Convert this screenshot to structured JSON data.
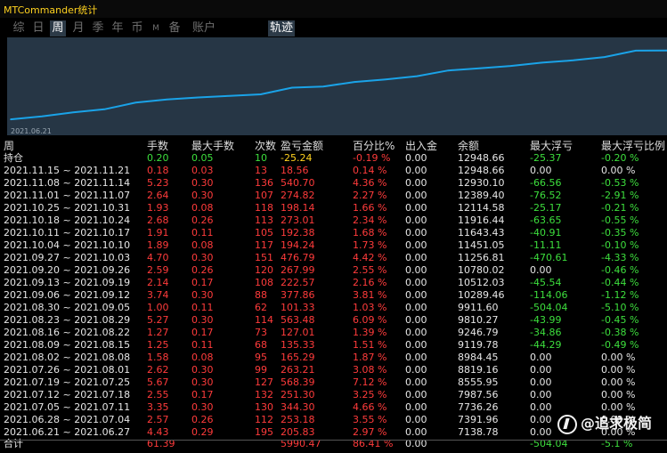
{
  "window": {
    "title": "MTCommander统计"
  },
  "tabs": [
    {
      "label": "综",
      "active": false
    },
    {
      "label": "日",
      "active": false
    },
    {
      "label": "周",
      "active": true
    },
    {
      "label": "月",
      "active": false
    },
    {
      "label": "季",
      "active": false
    },
    {
      "label": "年",
      "active": false
    },
    {
      "label": "币",
      "active": false
    },
    {
      "label": "M",
      "active": false
    },
    {
      "label": "备",
      "active": false
    },
    {
      "label": "账户",
      "active": false
    },
    {
      "label": "轨迹",
      "active": true
    }
  ],
  "chart_data": {
    "type": "line",
    "start_label": "2021.06.21",
    "x": [
      "2021.06.21",
      "2021.06.28",
      "2021.07.05",
      "2021.07.12",
      "2021.07.19",
      "2021.07.26",
      "2021.08.02",
      "2021.08.09",
      "2021.08.16",
      "2021.08.23",
      "2021.08.30",
      "2021.09.06",
      "2021.09.13",
      "2021.09.20",
      "2021.09.27",
      "2021.10.04",
      "2021.10.11",
      "2021.10.18",
      "2021.10.25",
      "2021.11.01",
      "2021.11.08",
      "2021.11.15"
    ],
    "values": [
      7138.78,
      7391.96,
      7736.26,
      7987.56,
      8555.95,
      8819.16,
      8984.45,
      9119.78,
      9246.79,
      9810.27,
      9911.6,
      10289.46,
      10512.03,
      10780.02,
      11256.81,
      11451.05,
      11643.43,
      11916.44,
      12114.58,
      12389.4,
      12930.1,
      12948.66
    ],
    "color": "#1aa3e8",
    "background": "#263645",
    "grid": false
  },
  "table": {
    "headers": [
      "周",
      "手数",
      "最大手数",
      "次数",
      "盈亏金额",
      "百分比%",
      "出入金",
      "余额",
      "最大浮亏",
      "最大浮亏比例"
    ],
    "position": {
      "label": "持仓",
      "cells": [
        "0.20",
        "0.05",
        "10",
        "-25.24",
        "-0.19 %",
        "0.00",
        "12948.66",
        "-25.37",
        "-0.20 %"
      ],
      "colors": [
        "green",
        "green",
        "green",
        "yellow",
        "red",
        "white",
        "white",
        "green",
        "green"
      ]
    },
    "rows": [
      [
        "2021.11.15 ~ 2021.11.21",
        "0.18",
        "0.03",
        "13",
        "18.56",
        "0.14 %",
        "0.00",
        "12948.66",
        "0.00",
        "0.00 %"
      ],
      [
        "2021.11.08 ~ 2021.11.14",
        "5.23",
        "0.30",
        "136",
        "540.70",
        "4.36 %",
        "0.00",
        "12930.10",
        "-66.56",
        "-0.53 %"
      ],
      [
        "2021.11.01 ~ 2021.11.07",
        "2.64",
        "0.30",
        "107",
        "274.82",
        "2.27 %",
        "0.00",
        "12389.40",
        "-76.52",
        "-2.91 %"
      ],
      [
        "2021.10.25 ~ 2021.10.31",
        "1.93",
        "0.08",
        "118",
        "198.14",
        "1.66 %",
        "0.00",
        "12114.58",
        "-25.17",
        "-0.21 %"
      ],
      [
        "2021.10.18 ~ 2021.10.24",
        "2.68",
        "0.26",
        "113",
        "273.01",
        "2.34 %",
        "0.00",
        "11916.44",
        "-63.65",
        "-0.55 %"
      ],
      [
        "2021.10.11 ~ 2021.10.17",
        "1.91",
        "0.11",
        "105",
        "192.38",
        "1.68 %",
        "0.00",
        "11643.43",
        "-40.91",
        "-0.35 %"
      ],
      [
        "2021.10.04 ~ 2021.10.10",
        "1.89",
        "0.08",
        "117",
        "194.24",
        "1.73 %",
        "0.00",
        "11451.05",
        "-11.11",
        "-0.10 %"
      ],
      [
        "2021.09.27 ~ 2021.10.03",
        "4.70",
        "0.30",
        "151",
        "476.79",
        "4.42 %",
        "0.00",
        "11256.81",
        "-470.61",
        "-4.33 %"
      ],
      [
        "2021.09.20 ~ 2021.09.26",
        "2.59",
        "0.26",
        "120",
        "267.99",
        "2.55 %",
        "0.00",
        "10780.02",
        "0.00",
        "-0.46 %"
      ],
      [
        "2021.09.13 ~ 2021.09.19",
        "2.14",
        "0.17",
        "108",
        "222.57",
        "2.16 %",
        "0.00",
        "10512.03",
        "-45.54",
        "-0.44 %"
      ],
      [
        "2021.09.06 ~ 2021.09.12",
        "3.74",
        "0.30",
        "88",
        "377.86",
        "3.81 %",
        "0.00",
        "10289.46",
        "-114.06",
        "-1.12 %"
      ],
      [
        "2021.08.30 ~ 2021.09.05",
        "1.00",
        "0.11",
        "62",
        "101.33",
        "1.03 %",
        "0.00",
        "9911.60",
        "-504.04",
        "-5.10 %"
      ],
      [
        "2021.08.23 ~ 2021.08.29",
        "5.27",
        "0.30",
        "114",
        "563.48",
        "6.09 %",
        "0.00",
        "9810.27",
        "-43.99",
        "-0.45 %"
      ],
      [
        "2021.08.16 ~ 2021.08.22",
        "1.27",
        "0.17",
        "73",
        "127.01",
        "1.39 %",
        "0.00",
        "9246.79",
        "-34.86",
        "-0.38 %"
      ],
      [
        "2021.08.09 ~ 2021.08.15",
        "1.25",
        "0.11",
        "68",
        "135.33",
        "1.51 %",
        "0.00",
        "9119.78",
        "-44.29",
        "-0.49 %"
      ],
      [
        "2021.08.02 ~ 2021.08.08",
        "1.58",
        "0.08",
        "95",
        "165.29",
        "1.87 %",
        "0.00",
        "8984.45",
        "0.00",
        "0.00 %"
      ],
      [
        "2021.07.26 ~ 2021.08.01",
        "2.62",
        "0.30",
        "99",
        "263.21",
        "3.08 %",
        "0.00",
        "8819.16",
        "0.00",
        "0.00 %"
      ],
      [
        "2021.07.19 ~ 2021.07.25",
        "5.67",
        "0.30",
        "127",
        "568.39",
        "7.12 %",
        "0.00",
        "8555.95",
        "0.00",
        "0.00 %"
      ],
      [
        "2021.07.12 ~ 2021.07.18",
        "2.55",
        "0.17",
        "132",
        "251.30",
        "3.25 %",
        "0.00",
        "7987.56",
        "0.00",
        "0.00 %"
      ],
      [
        "2021.07.05 ~ 2021.07.11",
        "3.35",
        "0.30",
        "130",
        "344.30",
        "4.66 %",
        "0.00",
        "7736.26",
        "0.00",
        "0.00 %"
      ],
      [
        "2021.06.28 ~ 2021.07.04",
        "2.57",
        "0.26",
        "112",
        "253.18",
        "3.55 %",
        "0.00",
        "7391.96",
        "0.00",
        "0.00 %"
      ],
      [
        "2021.06.21 ~ 2021.06.27",
        "4.43",
        "0.29",
        "195",
        "205.83",
        "2.97 %",
        "0.00",
        "7138.78",
        "0.00",
        "0.00 %"
      ]
    ],
    "total": {
      "label": "合计",
      "cells": [
        "61.39",
        "",
        "",
        "5990.47",
        "86.41 %",
        "0.00",
        "",
        "-504.04",
        "-5.1 %"
      ],
      "colors": [
        "red",
        "red",
        "red",
        "red",
        "red",
        "white",
        "white",
        "green",
        "green"
      ]
    }
  },
  "watermark": {
    "text": "@追求极简"
  },
  "colors": {
    "red": "#ff3b3b",
    "green": "#3ddf3d",
    "yellow": "#ffd21f",
    "white": "#e6e6e6",
    "line": "#1aa3e8"
  }
}
